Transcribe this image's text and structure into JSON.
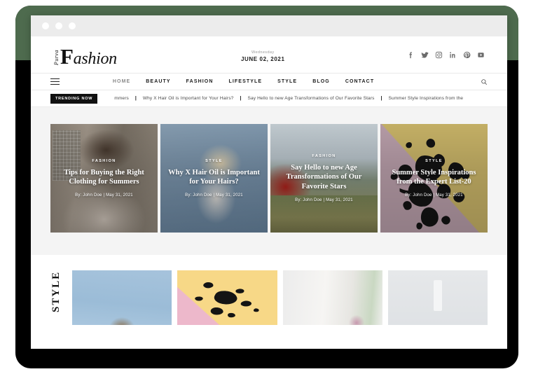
{
  "browser": {
    "dots": [
      "window-close",
      "window-minimize",
      "window-maximize"
    ]
  },
  "site": {
    "logo": {
      "small": "Purva",
      "main_cap": "F",
      "main_rest": "ashion"
    },
    "date": {
      "weekday": "Wednesday",
      "full": "JUNE 02, 2021"
    },
    "social": [
      {
        "name": "facebook-icon",
        "label": "f"
      },
      {
        "name": "twitter-icon",
        "label": "twitter"
      },
      {
        "name": "instagram-icon",
        "label": "instagram"
      },
      {
        "name": "linkedin-icon",
        "label": "in"
      },
      {
        "name": "pinterest-icon",
        "label": "pinterest"
      },
      {
        "name": "youtube-icon",
        "label": "youtube"
      }
    ],
    "nav": [
      {
        "label": "HOME",
        "muted": true
      },
      {
        "label": "BEAUTY",
        "muted": false
      },
      {
        "label": "FASHION",
        "muted": false
      },
      {
        "label": "LIFESTYLE",
        "muted": false
      },
      {
        "label": "STYLE",
        "muted": false
      },
      {
        "label": "BLOG",
        "muted": false
      },
      {
        "label": "CONTACT",
        "muted": false
      }
    ],
    "search_placeholder": "Search",
    "trending": {
      "badge": "TRENDING NOW",
      "items": [
        "mmers",
        "Why X Hair Oil is Important for Your Hairs?",
        "Say Hello to new Age Transformations of Our Favorite Stars",
        "Summer Style Inspirations from the"
      ],
      "separator": "|"
    }
  },
  "hero": {
    "cards": [
      {
        "category": "FASHION",
        "title": "Tips for Buying the Right Clothing for Summers",
        "meta": "By: John Doe | May 31, 2021",
        "art": "photo-c1"
      },
      {
        "category": "STYLE",
        "title": "Why X Hair Oil is Important for Your Hairs?",
        "meta": "By: John Doe | May 31, 2021",
        "art": "photo-c2"
      },
      {
        "category": "FASHION",
        "title": "Say Hello to new Age Transformations of Our Favorite Stars",
        "meta": "By: John Doe | May 31, 2021",
        "art": "photo-c3"
      },
      {
        "category": "STYLE",
        "title": "Summer Style Inspirations from the Expert List-20",
        "meta": "By: John Doe | May 31, 2021",
        "art": "photo-c4"
      }
    ]
  },
  "lower": {
    "section_label": "STYLE",
    "thumbs": [
      "thumb-1",
      "thumb-2",
      "thumb-3",
      "thumb-4"
    ]
  },
  "colors": {
    "bezel": "#000000",
    "bezel_accent": "#4e6b4e",
    "titlebar": "#ececec",
    "hero_bg": "#f4f4f4",
    "badge_bg": "#111111",
    "card4_yellow": "#d3bd6d",
    "card4_mauve": "#c3a7b3",
    "text_dark": "#1a1a1a"
  }
}
